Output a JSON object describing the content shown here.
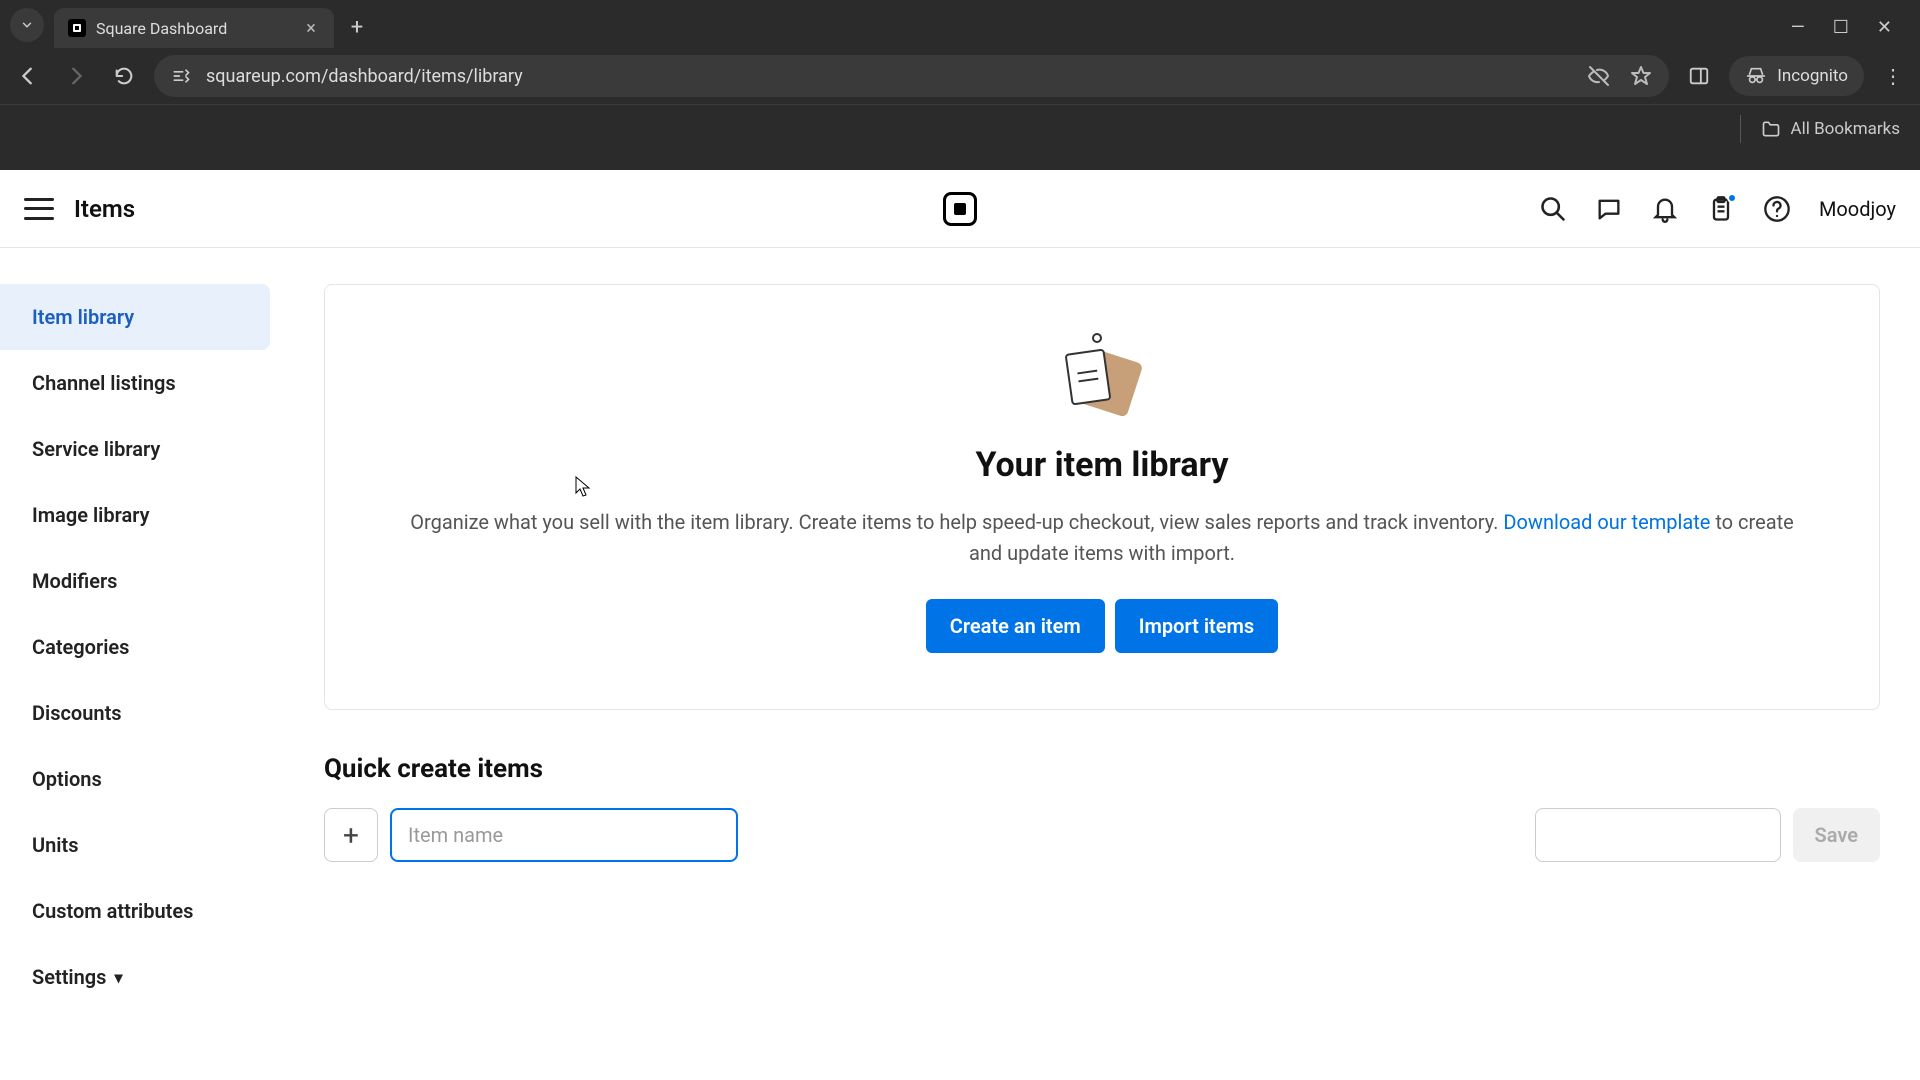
{
  "browser": {
    "tab_title": "Square Dashboard",
    "url": "squareup.com/dashboard/items/library",
    "incognito_label": "Incognito",
    "all_bookmarks": "All Bookmarks"
  },
  "header": {
    "page_title": "Items",
    "username": "Moodjoy"
  },
  "sidebar": {
    "items": [
      {
        "label": "Item library",
        "active": true
      },
      {
        "label": "Channel listings"
      },
      {
        "label": "Service library"
      },
      {
        "label": "Image library"
      },
      {
        "label": "Modifiers"
      },
      {
        "label": "Categories"
      },
      {
        "label": "Discounts"
      },
      {
        "label": "Options"
      },
      {
        "label": "Units"
      },
      {
        "label": "Custom attributes"
      },
      {
        "label": "Settings",
        "has_chevron": true
      }
    ]
  },
  "panel": {
    "heading": "Your item library",
    "desc_pre": "Organize what you sell with the item library. Create items to help speed-up checkout, view sales reports and track inventory. ",
    "link_text": "Download our template",
    "desc_post": " to create and update items with import.",
    "create_btn": "Create an item",
    "import_btn": "Import items"
  },
  "quick": {
    "title": "Quick create items",
    "placeholder": "Item name",
    "save_label": "Save"
  }
}
